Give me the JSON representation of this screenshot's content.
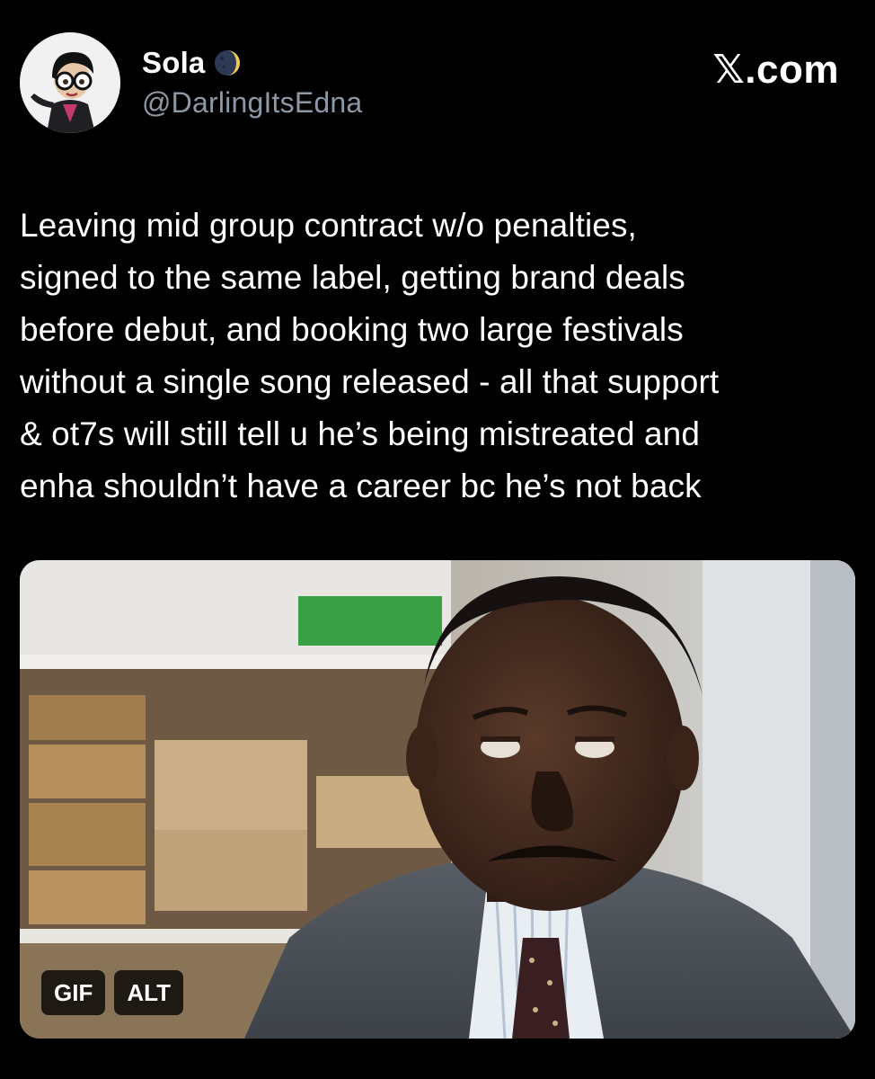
{
  "author": {
    "display_name": "Sola",
    "handle": "@DarlingItsEdna",
    "badge_icon": "moon-icon",
    "avatar_icon": "edna-cartoon-avatar"
  },
  "brand": {
    "label": "𝕏.com"
  },
  "tweet": {
    "text": "Leaving mid group contract w/o penalties,\nsigned to the same label, getting brand deals\nbefore debut, and booking two large festivals\nwithout a single song released - all that support\n& ot7s will still tell u he’s being mistreated and\nenha shouldn’t have a career bc he’s not back"
  },
  "media": {
    "type": "gif",
    "gif_label": "GIF",
    "alt_label": "ALT"
  },
  "colors": {
    "background": "#000000",
    "text": "#ffffff",
    "secondary_text": "#8b98a5"
  }
}
